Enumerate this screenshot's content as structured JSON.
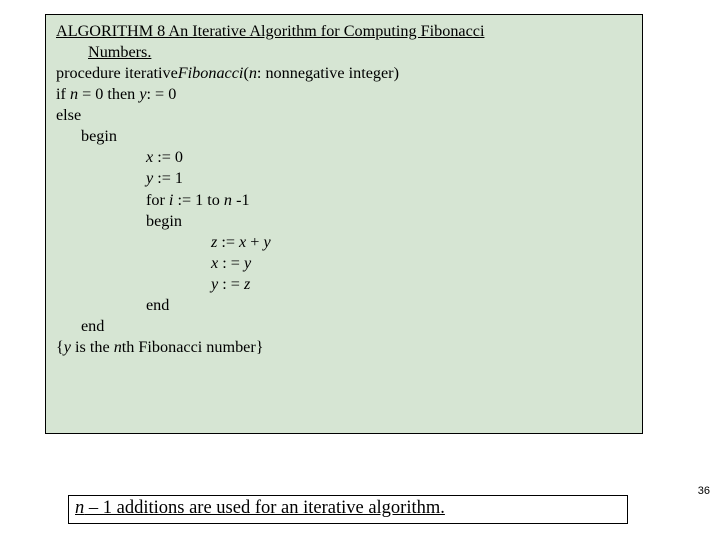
{
  "algo": {
    "title1": "ALGORITHM 8  An Iterative Algorithm for Computing Fibonacci",
    "title2": "Numbers.",
    "proc_a": "procedure iterative",
    "proc_b": "Fibonacci",
    "proc_c": "(",
    "proc_d": "n",
    "proc_e": ": nonnegative integer)",
    "if_a": "if ",
    "if_b": "n",
    "if_c": " = 0 then ",
    "if_d": "y",
    "if_e": ": = 0",
    "else": "else",
    "begin1": "begin",
    "x_a": "x",
    "x_b": " := 0",
    "y_a": "y",
    "y_b": " := 1",
    "for_a": "for ",
    "for_b": "i",
    "for_c": " := 1 to ",
    "for_d": "n",
    "for_e": " -1",
    "begin2": "begin",
    "z_a": "z",
    "z_b": " := ",
    "z_c": "x",
    "z_d": " + ",
    "z_e": "y",
    "x2_a": "x",
    "x2_b": " : = ",
    "x2_c": "y",
    "y2_a": "y",
    "y2_b": " : = ",
    "y2_c": "z",
    "end1": "end",
    "end2": "end",
    "post_a": "{",
    "post_b": "y",
    "post_c": " is the ",
    "post_d": "n",
    "post_e": "th Fibonacci number}"
  },
  "bottom": {
    "a": "n",
    "b": " – 1 additions are used for an iterative algorithm."
  },
  "page": "36"
}
